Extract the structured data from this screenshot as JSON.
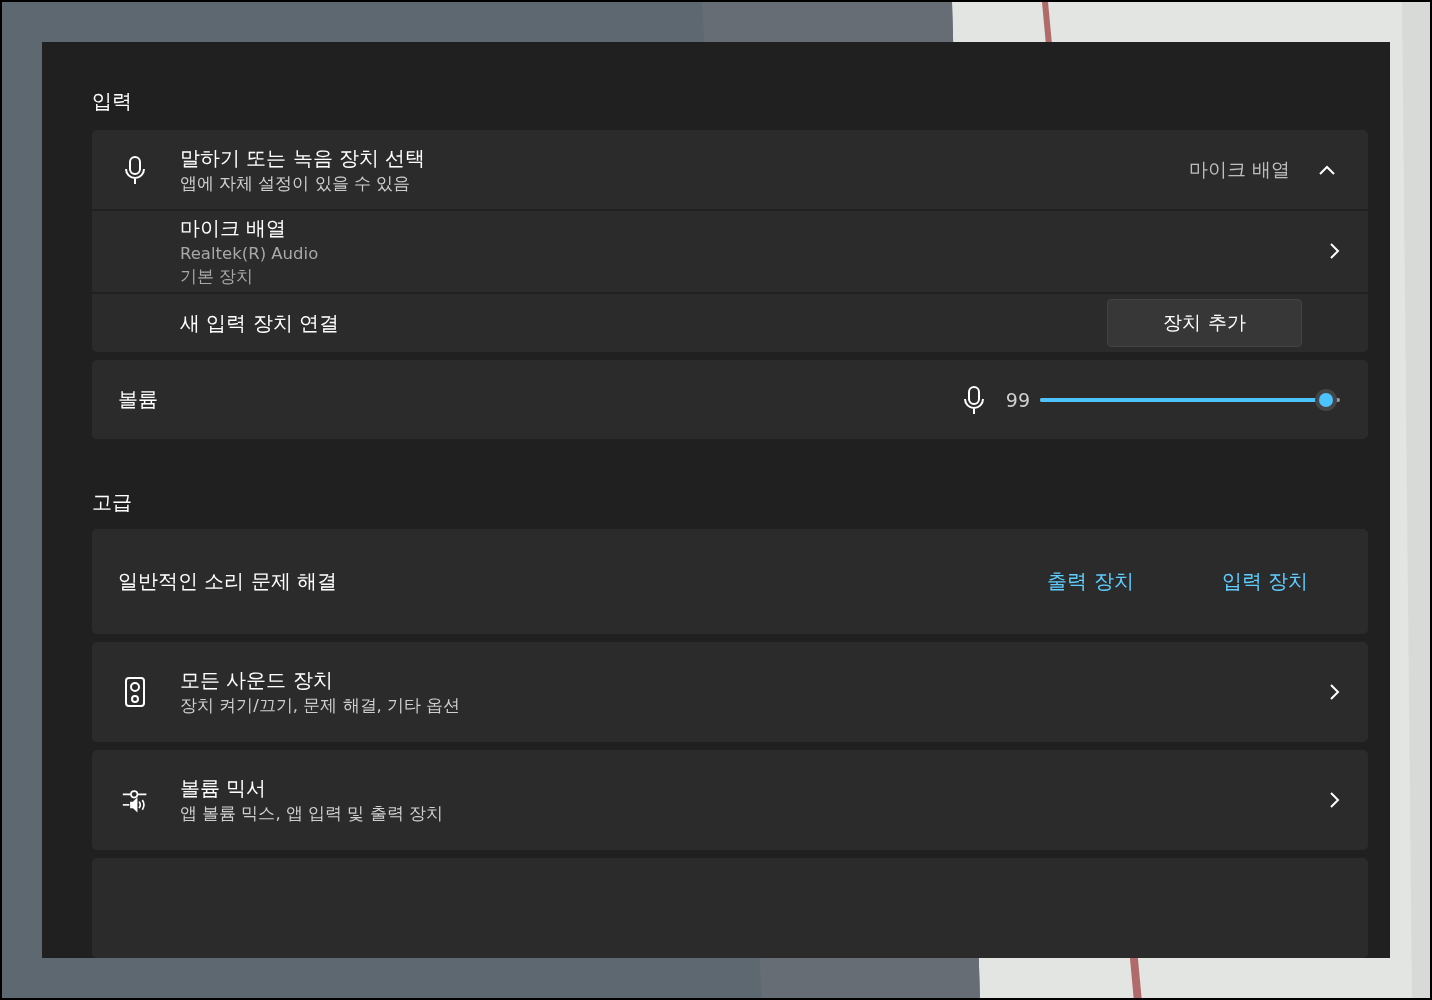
{
  "input_section": {
    "heading": "입력",
    "device_select": {
      "title": "말하기 또는 녹음 장치 선택",
      "subtitle": "앱에 자체 설정이 있을 수 있음",
      "value": "마이크 배열",
      "expanded": true
    },
    "devices": [
      {
        "name": "마이크 배열",
        "driver": "Realtek(R) Audio",
        "status": "기본 장치"
      }
    ],
    "add_device": {
      "label": "새 입력 장치 연결",
      "button": "장치 추가"
    },
    "volume": {
      "label": "볼륨",
      "reading": "99",
      "level": 0.99
    }
  },
  "advanced_section": {
    "heading": "고급",
    "troubleshoot": {
      "label": "일반적인 소리 문제 해결",
      "links": [
        "출력 장치",
        "입력 장치"
      ]
    },
    "items": [
      {
        "kind": "speaker",
        "title": "모든 사운드 장치",
        "subtitle": "장치 켜기/끄기, 문제 해결, 기타 옵션"
      },
      {
        "kind": "mixer",
        "title": "볼륨 믹서",
        "subtitle": "앱 볼륨 믹스, 앱 입력 및 출력 장치"
      }
    ]
  }
}
